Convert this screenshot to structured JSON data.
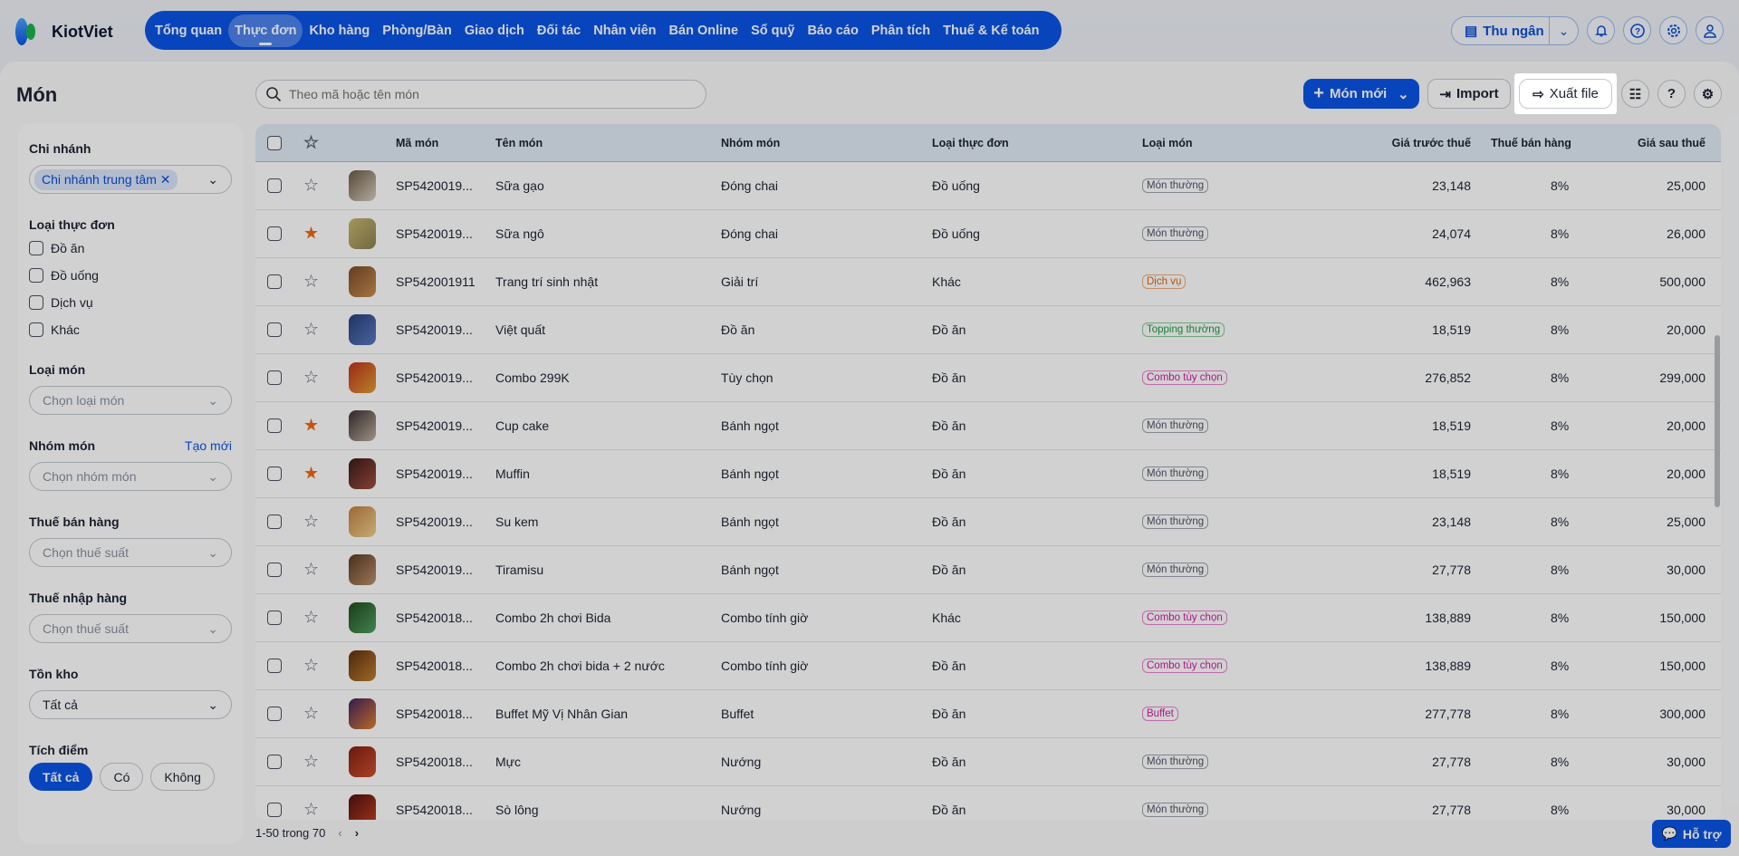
{
  "app": {
    "name": "KiotViet"
  },
  "nav": [
    "Tổng quan",
    "Thực đơn",
    "Kho hàng",
    "Phòng/Bàn",
    "Giao dịch",
    "Đối tác",
    "Nhân viên",
    "Bán Online",
    "Sổ quỹ",
    "Báo cáo",
    "Phân tích",
    "Thuế & Kế toán"
  ],
  "nav_active": 1,
  "header": {
    "cashier": "Thu ngân"
  },
  "page": {
    "title": "Món",
    "search_placeholder": "Theo mã hoặc tên món",
    "new_btn": "Món mới",
    "import_btn": "Import",
    "export_btn": "Xuất file"
  },
  "filters": {
    "branch_label": "Chi nhánh",
    "branch_value": "Chi nhánh trung tâm",
    "menu_type_label": "Loại thực đơn",
    "menu_types": [
      "Đồ ăn",
      "Đồ uống",
      "Dịch vụ",
      "Khác"
    ],
    "dish_type_label": "Loại món",
    "dish_type_placeholder": "Chọn loại món",
    "group_label": "Nhóm món",
    "group_create": "Tạo mới",
    "group_placeholder": "Chọn nhóm món",
    "sales_tax_label": "Thuế bán hàng",
    "sales_tax_placeholder": "Chọn thuế suất",
    "import_tax_label": "Thuế nhập hàng",
    "import_tax_placeholder": "Chọn thuế suất",
    "stock_label": "Tồn kho",
    "stock_value": "Tất cả",
    "points_label": "Tích điểm",
    "points_options": [
      "Tất cả",
      "Có",
      "Không"
    ]
  },
  "table": {
    "headers": [
      "Mã món",
      "Tên món",
      "Nhóm món",
      "Loại thực đơn",
      "Loại món",
      "Giá trước thuế",
      "Thuế bán hàng",
      "Giá sau thuế"
    ],
    "rows": [
      {
        "code": "SP5420019...",
        "name": "Sữa gạo",
        "group": "Đóng chai",
        "menu": "Đồ uống",
        "type": "Món thường",
        "pre": "23,148",
        "tax": "8%",
        "post": "25,000",
        "fav": false
      },
      {
        "code": "SP5420019...",
        "name": "Sữa ngô",
        "group": "Đóng chai",
        "menu": "Đồ uống",
        "type": "Món thường",
        "pre": "24,074",
        "tax": "8%",
        "post": "26,000",
        "fav": true
      },
      {
        "code": "SP542001911",
        "name": "Trang trí sinh nhật",
        "group": "Giải trí",
        "menu": "Khác",
        "type": "Dịch vụ",
        "pre": "462,963",
        "tax": "8%",
        "post": "500,000",
        "fav": false
      },
      {
        "code": "SP5420019...",
        "name": "Việt quất",
        "group": "Đồ ăn",
        "menu": "Đồ ăn",
        "type": "Topping thường",
        "pre": "18,519",
        "tax": "8%",
        "post": "20,000",
        "fav": false
      },
      {
        "code": "SP5420019...",
        "name": "Combo 299K",
        "group": "Tùy chọn",
        "menu": "Đồ ăn",
        "type": "Combo tùy chọn",
        "pre": "276,852",
        "tax": "8%",
        "post": "299,000",
        "fav": false
      },
      {
        "code": "SP5420019...",
        "name": "Cup cake",
        "group": "Bánh ngọt",
        "menu": "Đồ ăn",
        "type": "Món thường",
        "pre": "18,519",
        "tax": "8%",
        "post": "20,000",
        "fav": true
      },
      {
        "code": "SP5420019...",
        "name": "Muffin",
        "group": "Bánh ngọt",
        "menu": "Đồ ăn",
        "type": "Món thường",
        "pre": "18,519",
        "tax": "8%",
        "post": "20,000",
        "fav": true
      },
      {
        "code": "SP5420019...",
        "name": "Su kem",
        "group": "Bánh ngọt",
        "menu": "Đồ ăn",
        "type": "Món thường",
        "pre": "23,148",
        "tax": "8%",
        "post": "25,000",
        "fav": false
      },
      {
        "code": "SP5420019...",
        "name": "Tiramisu",
        "group": "Bánh ngọt",
        "menu": "Đồ ăn",
        "type": "Món thường",
        "pre": "27,778",
        "tax": "8%",
        "post": "30,000",
        "fav": false
      },
      {
        "code": "SP5420018...",
        "name": "Combo 2h chơi Bida",
        "group": "Combo tính giờ",
        "menu": "Khác",
        "type": "Combo tùy chọn",
        "pre": "138,889",
        "tax": "8%",
        "post": "150,000",
        "fav": false
      },
      {
        "code": "SP5420018...",
        "name": "Combo 2h chơi bida + 2 nước",
        "group": "Combo tính giờ",
        "menu": "Đồ ăn",
        "type": "Combo tùy chọn",
        "pre": "138,889",
        "tax": "8%",
        "post": "150,000",
        "fav": false
      },
      {
        "code": "SP5420018...",
        "name": "Buffet Mỹ Vị Nhân Gian",
        "group": "Buffet",
        "menu": "Đồ ăn",
        "type": "Buffet",
        "pre": "277,778",
        "tax": "8%",
        "post": "300,000",
        "fav": false
      },
      {
        "code": "SP5420018...",
        "name": "Mực",
        "group": "Nướng",
        "menu": "Đồ ăn",
        "type": "Món thường",
        "pre": "27,778",
        "tax": "8%",
        "post": "30,000",
        "fav": false
      },
      {
        "code": "SP5420018...",
        "name": "Sò lông",
        "group": "Nướng",
        "menu": "Đồ ăn",
        "type": "Món thường",
        "pre": "27,778",
        "tax": "8%",
        "post": "30,000",
        "fav": false
      }
    ],
    "tag_colors": {
      "Món thường": "#4a5263",
      "Dịch vụ": "#e0660c",
      "Topping thường": "#1a9e3f",
      "Combo tùy chọn": "#d01aa6",
      "Buffet": "#d01aa6"
    }
  },
  "pager": {
    "text": "1-50 trong 70"
  },
  "support": {
    "label": "Hỗ trợ"
  }
}
